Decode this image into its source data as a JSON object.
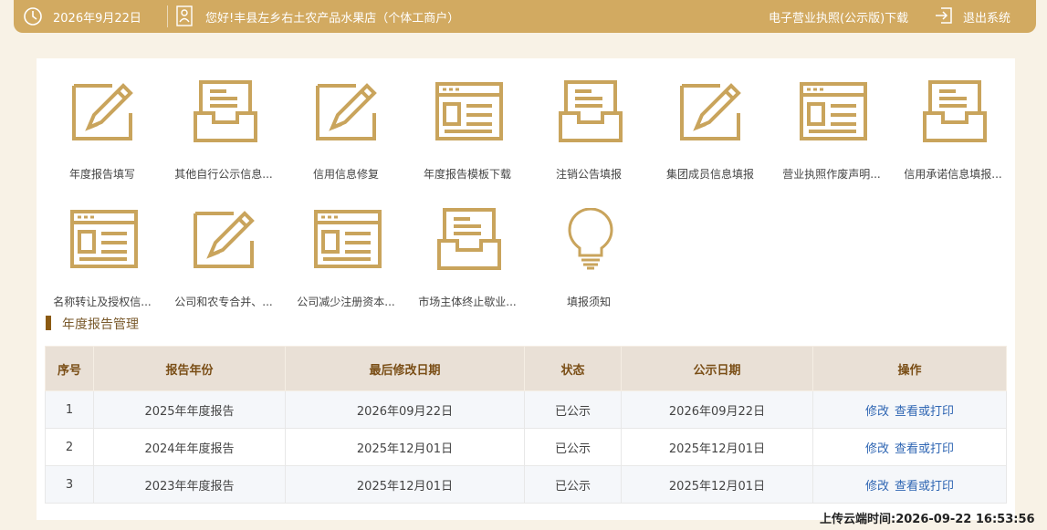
{
  "header": {
    "date": "2026年9月22日",
    "greeting": "您好!丰县左乡右土农产品水果店（个体工商户）",
    "license_link": "电子营业执照(公示版)下载",
    "logout": "退出系统"
  },
  "tiles": [
    {
      "label": "年度报告填写",
      "icon": "pencil-form-icon"
    },
    {
      "label": "其他自行公示信息...",
      "icon": "inbox-tray-icon"
    },
    {
      "label": "信用信息修复",
      "icon": "pencil-form-icon"
    },
    {
      "label": "年度报告模板下载",
      "icon": "browser-form-icon"
    },
    {
      "label": "注销公告填报",
      "icon": "inbox-tray-icon"
    },
    {
      "label": "集团成员信息填报",
      "icon": "pencil-form-icon"
    },
    {
      "label": "营业执照作废声明...",
      "icon": "browser-form-icon"
    },
    {
      "label": "信用承诺信息填报...",
      "icon": "inbox-tray-icon"
    },
    {
      "label": "名称转让及授权信...",
      "icon": "browser-form-icon"
    },
    {
      "label": "公司和农专合并、...",
      "icon": "pencil-form-icon"
    },
    {
      "label": "公司减少注册资本...",
      "icon": "browser-form-icon"
    },
    {
      "label": "市场主体终止歇业...",
      "icon": "inbox-tray-icon"
    },
    {
      "label": "填报须知",
      "icon": "lightbulb-icon"
    }
  ],
  "section": {
    "title": "年度报告管理"
  },
  "table": {
    "headers": [
      "序号",
      "报告年份",
      "最后修改日期",
      "状态",
      "公示日期",
      "操作"
    ],
    "rows": [
      {
        "no": "1",
        "year": "2025年年度报告",
        "modified": "2026年09月22日",
        "status": "已公示",
        "published": "2026年09月22日",
        "edit": "修改",
        "view": "查看或打印"
      },
      {
        "no": "2",
        "year": "2024年年度报告",
        "modified": "2025年12月01日",
        "status": "已公示",
        "published": "2025年12月01日",
        "edit": "修改",
        "view": "查看或打印"
      },
      {
        "no": "3",
        "year": "2023年年度报告",
        "modified": "2025年12月01日",
        "status": "已公示",
        "published": "2025年12月01日",
        "edit": "修改",
        "view": "查看或打印"
      }
    ]
  },
  "footer": {
    "upload_time": "上传云端时间:2026-09-22 16:53:56"
  },
  "colors": {
    "accent": "#d2aa61",
    "icon": "#c9a45c",
    "link": "#2f66b3",
    "section_bar": "#8b5a12"
  }
}
